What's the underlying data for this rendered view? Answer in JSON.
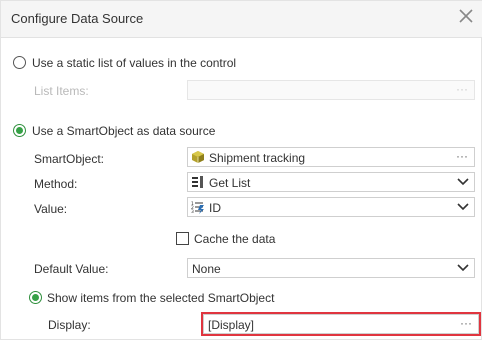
{
  "dialog": {
    "title": "Configure Data Source"
  },
  "static_option": {
    "label": "Use a static list of values in the control",
    "list_items_label": "List Items:",
    "list_items_value": "",
    "selected": false
  },
  "smartobject_option": {
    "label": "Use a SmartObject as data source",
    "selected": true
  },
  "fields": {
    "smartobject": {
      "label": "SmartObject:",
      "value": "Shipment tracking",
      "icon": "smartobject-cube-icon"
    },
    "method": {
      "label": "Method:",
      "value": "Get List",
      "icon": "list-method-icon"
    },
    "value": {
      "label": "Value:",
      "value": "ID",
      "icon": "numbered-field-icon"
    },
    "cache": {
      "label": "Cache the data",
      "checked": false
    },
    "default_value": {
      "label": "Default Value:",
      "value": "None"
    }
  },
  "show_items_option": {
    "label": "Show items from the selected SmartObject",
    "selected": true
  },
  "display": {
    "label": "Display:",
    "value": "[Display]"
  },
  "ellipsis": "···",
  "colors": {
    "header_bg": "#f5f5f5",
    "radio_green": "#36a146",
    "smartobject_icon": "#9b8c22",
    "highlight_red": "#e0353f"
  }
}
